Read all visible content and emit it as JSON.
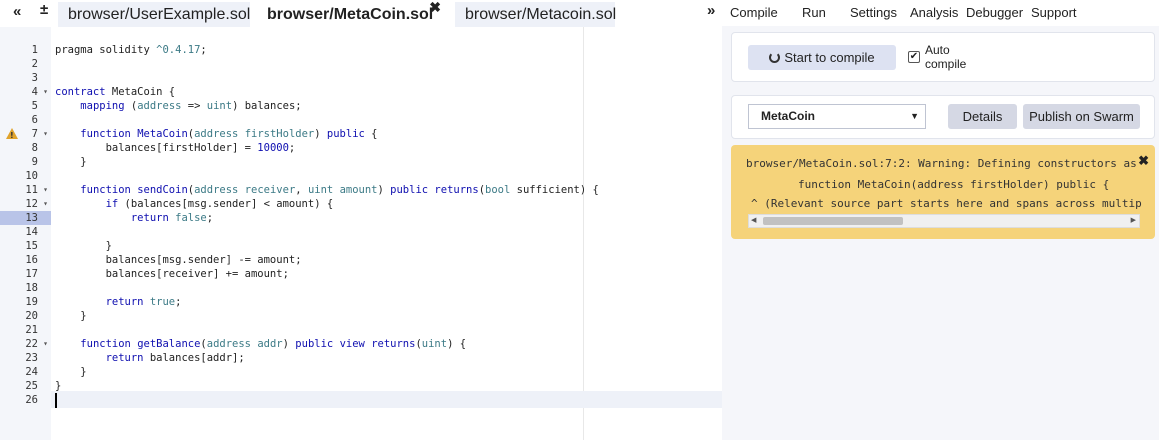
{
  "tabbar": {
    "collapse_glyph": "«",
    "add_glyph": "±",
    "tabs": [
      {
        "label": "browser/UserExample.sol"
      },
      {
        "label": "browser/MetaCoin.sol",
        "close_glyph": "✖"
      },
      {
        "label": "browser/Metacoin.sol"
      }
    ]
  },
  "editor": {
    "active_line": 13,
    "warning_line": 7,
    "lines": [
      {
        "n": "1",
        "fold": "",
        "html": "pragma solidity <span class=\"ty\">^0.4.17</span>;"
      },
      {
        "n": "2",
        "fold": "",
        "html": ""
      },
      {
        "n": "3",
        "fold": "",
        "html": ""
      },
      {
        "n": "4",
        "fold": "▾",
        "html": "<span class=\"kw\">contract</span> MetaCoin {"
      },
      {
        "n": "5",
        "fold": "",
        "html": "    <span class=\"kw\">mapping</span> (<span class=\"ty\">address</span> => <span class=\"ty\">uint</span>) balances;"
      },
      {
        "n": "6",
        "fold": "",
        "html": ""
      },
      {
        "n": "7",
        "fold": "▾",
        "html": "    <span class=\"kw\">function</span> <span class=\"kw\">MetaCoin</span>(<span class=\"ty\">address</span> <span class=\"ty\">firstHolder</span>) <span class=\"kw\">public</span> {"
      },
      {
        "n": "8",
        "fold": "",
        "html": "        balances[firstHolder] = <span class=\"kw\">10000</span>;"
      },
      {
        "n": "9",
        "fold": "",
        "html": "    }"
      },
      {
        "n": "10",
        "fold": "",
        "html": ""
      },
      {
        "n": "11",
        "fold": "▾",
        "html": "    <span class=\"kw\">function</span> <span class=\"kw\">sendCoin</span>(<span class=\"ty\">address</span> <span class=\"ty\">receiver</span>, <span class=\"ty\">uint</span> <span class=\"ty\">amount</span>) <span class=\"kw\">public</span> <span class=\"kw\">returns</span>(<span class=\"ty\">bool</span> sufficient) {"
      },
      {
        "n": "12",
        "fold": "▾",
        "html": "        <span class=\"kw\">if</span> (balances[msg.sender] < amount) {"
      },
      {
        "n": "13",
        "fold": "",
        "html": "            <span class=\"kw\">return</span> <span class=\"ty\">false</span>;"
      },
      {
        "n": "14",
        "fold": "",
        "html": ""
      },
      {
        "n": "15",
        "fold": "",
        "html": "        }"
      },
      {
        "n": "16",
        "fold": "",
        "html": "        balances[msg.sender] -= amount;"
      },
      {
        "n": "17",
        "fold": "",
        "html": "        balances[receiver] += amount;"
      },
      {
        "n": "18",
        "fold": "",
        "html": ""
      },
      {
        "n": "19",
        "fold": "",
        "html": "        <span class=\"kw\">return</span> <span class=\"ty\">true</span>;"
      },
      {
        "n": "20",
        "fold": "",
        "html": "    }"
      },
      {
        "n": "21",
        "fold": "",
        "html": ""
      },
      {
        "n": "22",
        "fold": "▾",
        "html": "    <span class=\"kw\">function</span> <span class=\"kw\">getBalance</span>(<span class=\"ty\">address</span> <span class=\"ty\">addr</span>) <span class=\"kw\">public</span> <span class=\"kw\">view</span> <span class=\"kw\">returns</span>(<span class=\"ty\">uint</span>) {"
      },
      {
        "n": "23",
        "fold": "",
        "html": "        <span class=\"kw\">return</span> balances[addr];"
      },
      {
        "n": "24",
        "fold": "",
        "html": "    }"
      },
      {
        "n": "25",
        "fold": "",
        "html": "}"
      },
      {
        "n": "26",
        "fold": "",
        "html": ""
      }
    ]
  },
  "panel": {
    "expand_glyph": "»",
    "menu": [
      "Compile",
      "Run",
      "Settings",
      "Analysis",
      "Debugger",
      "Support"
    ],
    "compile_button": "Start to compile",
    "auto_compile": {
      "label": "Auto compile",
      "checked": true,
      "check_glyph": "✔"
    },
    "contract_select": {
      "value": "MetaCoin",
      "arrow": "▼"
    },
    "details_button": "Details",
    "publish_button": "Publish on Swarm",
    "warning": {
      "line1": "browser/MetaCoin.sol:7:2: Warning: Defining constructors as",
      "line2": "function MetaCoin(address firstHolder) public {",
      "line3": "^ (Relevant source part starts here and spans across multip",
      "close_glyph": "✖",
      "scroll_left": "◀",
      "scroll_right": "▶"
    }
  },
  "colors": {
    "keyword": "#0f0fb0",
    "type": "#3c7a86",
    "warning_bg": "#f5d37a",
    "active_gutter": "#b9c4e8"
  }
}
